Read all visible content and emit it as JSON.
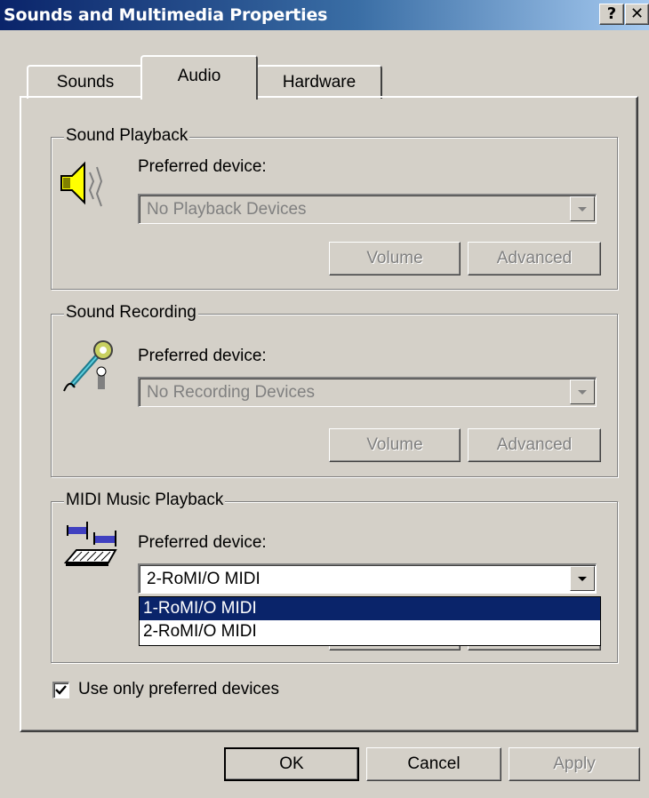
{
  "window": {
    "title": "Sounds and Multimedia Properties",
    "help_glyph": "?",
    "close_glyph": "✕"
  },
  "tabs": [
    {
      "label": "Sounds",
      "active": false
    },
    {
      "label": "Audio",
      "active": true
    },
    {
      "label": "Hardware",
      "active": false
    }
  ],
  "sound_playback": {
    "title": "Sound Playback",
    "icon": "speaker-icon",
    "preferred_label": "Preferred device:",
    "device_value": "No Playback Devices",
    "volume_label": "Volume",
    "advanced_label": "Advanced"
  },
  "sound_recording": {
    "title": "Sound Recording",
    "icon": "microphone-icon",
    "preferred_label": "Preferred device:",
    "device_value": "No Recording Devices",
    "volume_label": "Volume",
    "advanced_label": "Advanced"
  },
  "midi_playback": {
    "title": "MIDI Music Playback",
    "icon": "midi-keyboard-icon",
    "preferred_label": "Preferred device:",
    "device_value": "2-RoMI/O MIDI",
    "options": [
      "1-RoMI/O MIDI",
      "2-RoMI/O MIDI"
    ],
    "highlighted_option": "1-RoMI/O MIDI"
  },
  "use_preferred": {
    "label": "Use only preferred devices",
    "checked": true
  },
  "footer": {
    "ok_label": "OK",
    "cancel_label": "Cancel",
    "apply_label": "Apply"
  },
  "colors": {
    "title_bar": "#0a246a",
    "face": "#d4d0c8",
    "highlight": "#0a246a"
  }
}
